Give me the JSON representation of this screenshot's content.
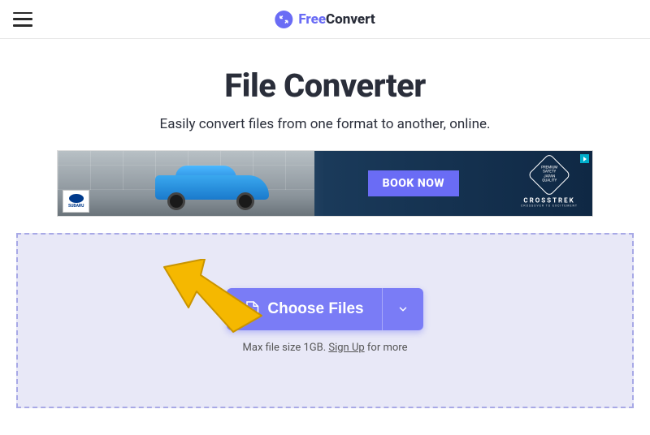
{
  "header": {
    "brand_free": "Free",
    "brand_convert": "Convert"
  },
  "hero": {
    "title": "File Converter",
    "subtitle": "Easily convert files from one format to another, online."
  },
  "ad": {
    "cta_label": "BOOK NOW",
    "brand_small": "SUBARU",
    "product": "CROSSTREK",
    "tagline": "CROSSOVER TO EXCITEMENT",
    "badge_line1": "PREMIUM",
    "badge_line2": "SAFETY",
    "badge_line3": "JAPAN",
    "badge_line4": "QUALITY"
  },
  "dropzone": {
    "choose_label": "Choose Files",
    "hint_prefix": "Max file size 1GB. ",
    "signup_label": "Sign Up",
    "hint_suffix": " for more"
  }
}
